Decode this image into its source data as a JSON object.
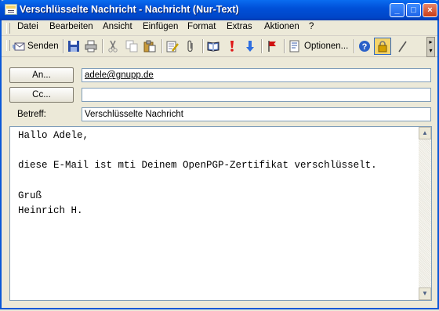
{
  "window": {
    "title": "Verschlüsselte Nachricht - Nachricht (Nur-Text)"
  },
  "title_buttons": {
    "minimize": "_",
    "maximize": "□",
    "close": "×"
  },
  "menu": [
    {
      "label": "Datei"
    },
    {
      "label": "Bearbeiten"
    },
    {
      "label": "Ansicht"
    },
    {
      "label": "Einfügen"
    },
    {
      "label": "Format"
    },
    {
      "label": "Extras"
    },
    {
      "label": "Aktionen"
    },
    {
      "label": "?"
    }
  ],
  "toolbar": {
    "send_label": "Senden",
    "options_label": "Optionen...",
    "icons": [
      "send-icon",
      "save-icon",
      "print-icon",
      "cut-icon",
      "copy-icon",
      "paste-icon",
      "edit-icon",
      "attach-icon",
      "addressbook-icon",
      "importance-high-icon",
      "importance-low-icon",
      "flag-icon",
      "options-icon",
      "help-icon",
      "encrypt-lock-icon",
      "sign-pen-icon"
    ]
  },
  "fields": {
    "to_button": "An...",
    "to_value": "adele@gnupp.de",
    "cc_button": "Cc...",
    "cc_value": "",
    "subject_label": "Betreff:",
    "subject_value": "Verschlüsselte Nachricht"
  },
  "body": {
    "text": "Hallo Adele,\n\ndiese E-Mail ist mti Deinem OpenPGP-Zertifikat verschlüsselt.\n\nGruß\nHeinrich H."
  },
  "scrollbar": {
    "up": "▲",
    "down": "▼"
  },
  "colors": {
    "titlebar": "#0050d8",
    "chrome": "#ece9d8",
    "input_border": "#7f9db9"
  }
}
